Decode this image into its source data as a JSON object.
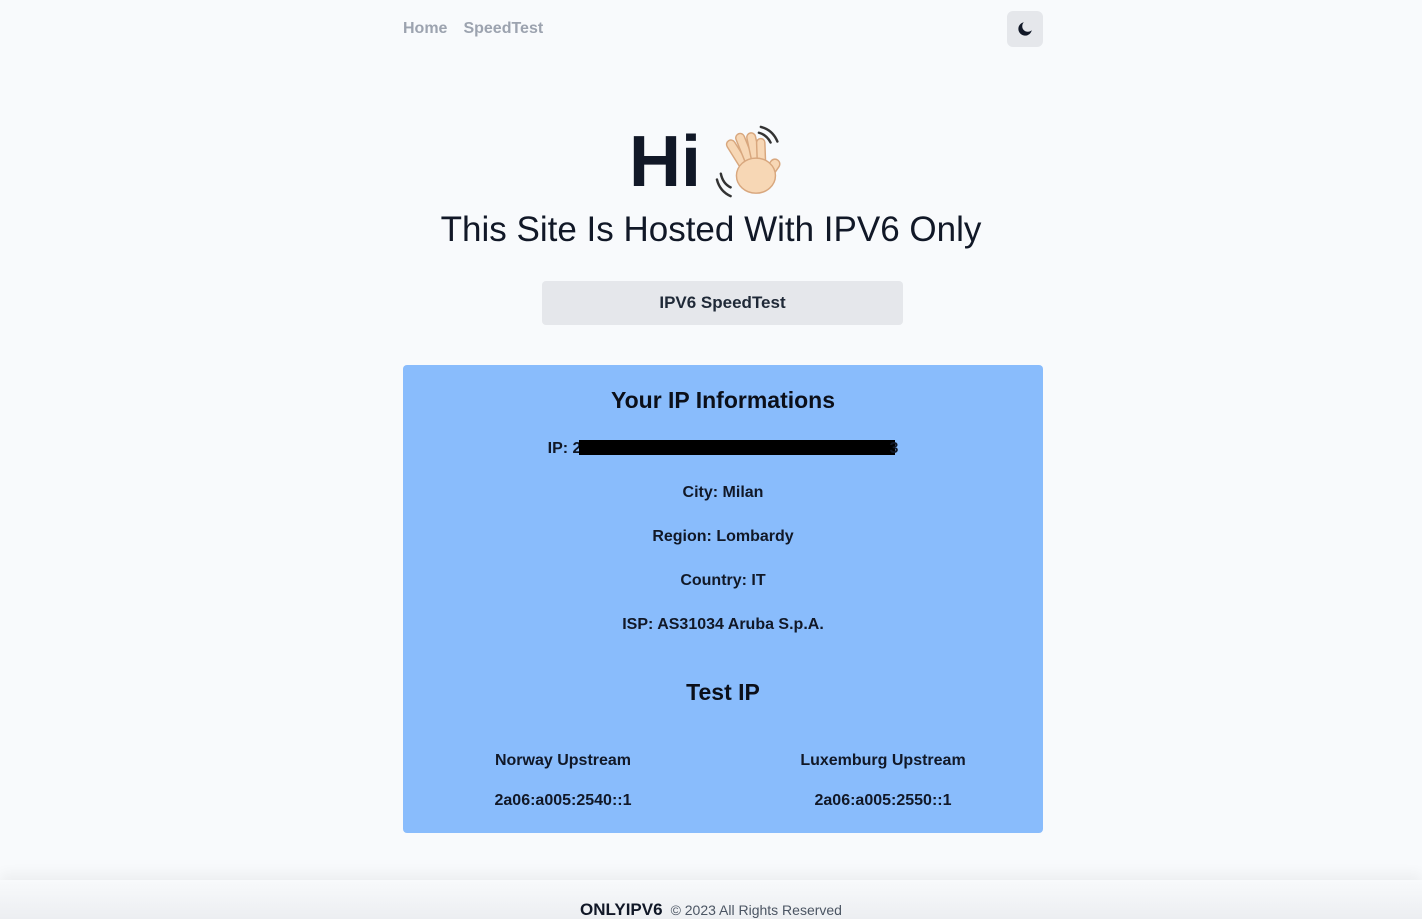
{
  "nav": {
    "links": [
      {
        "label": "Home"
      },
      {
        "label": "SpeedTest"
      }
    ],
    "theme_toggle_icon": "moon-icon"
  },
  "hero": {
    "greeting": "Hi",
    "greeting_icon": "waving-hand-icon",
    "subtitle": "This Site Is Hosted With IPV6 Only",
    "button_label": "IPV6 SpeedTest"
  },
  "info_card": {
    "title": "Your IP Informations",
    "ip_label": "IP: 2",
    "ip_suffix": "3",
    "city": "City: Milan",
    "region": "Region: Lombardy",
    "country": "Country: IT",
    "isp": "ISP: AS31034 Aruba S.p.A.",
    "test_title": "Test IP",
    "tests": [
      {
        "name": "Norway Upstream",
        "ip": "2a06:a005:2540::1"
      },
      {
        "name": "Luxemburg Upstream",
        "ip": "2a06:a005:2550::1"
      }
    ],
    "background": "#89bcfc"
  },
  "footer": {
    "brand": "ONLYIPV6",
    "copyright": "© 2023 All Rights Reserved"
  }
}
